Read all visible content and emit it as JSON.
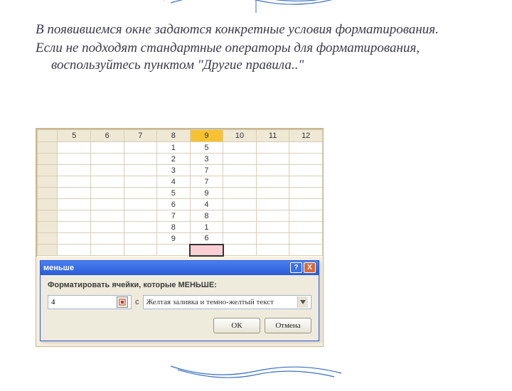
{
  "slide": {
    "p1": "В появившемся окне задаются конкретные условия форматирования.",
    "p2": "Если не подходят стандартные операторы для форматирования, воспользуйтесь пунктом \"Другие правила..\""
  },
  "excel": {
    "columns": [
      "5",
      "6",
      "7",
      "8",
      "9",
      "10",
      "11",
      "12"
    ],
    "selected_col_index": 4,
    "rows": [
      {
        "h": "",
        "cells": [
          "",
          "",
          "",
          "1",
          "5",
          "",
          "",
          ""
        ]
      },
      {
        "h": "",
        "cells": [
          "",
          "",
          "",
          "2",
          "3",
          "",
          "",
          ""
        ]
      },
      {
        "h": "",
        "cells": [
          "",
          "",
          "",
          "3",
          "7",
          "",
          "",
          ""
        ]
      },
      {
        "h": "",
        "cells": [
          "",
          "",
          "",
          "4",
          "7",
          "",
          "",
          ""
        ]
      },
      {
        "h": "",
        "cells": [
          "",
          "",
          "",
          "5",
          "9",
          "",
          "",
          ""
        ]
      },
      {
        "h": "",
        "cells": [
          "",
          "",
          "",
          "6",
          "4",
          "",
          "",
          ""
        ]
      },
      {
        "h": "",
        "cells": [
          "",
          "",
          "",
          "7",
          "8",
          "",
          "",
          ""
        ]
      },
      {
        "h": "",
        "cells": [
          "",
          "",
          "",
          "8",
          "1",
          "",
          "",
          ""
        ]
      },
      {
        "h": "",
        "cells": [
          "",
          "",
          "",
          "9",
          "6",
          "",
          "",
          ""
        ]
      }
    ],
    "pink_row_col": 4
  },
  "dialog": {
    "title": "меньше",
    "help_symbol": "?",
    "close_symbol": "X",
    "label": "Форматировать ячейки, которые МЕНЬШЕ:",
    "input_value": "4",
    "separator": "с",
    "select_value": "Желтая заливка и темно-желтый текст",
    "ok": "ОК",
    "cancel": "Отмена"
  }
}
